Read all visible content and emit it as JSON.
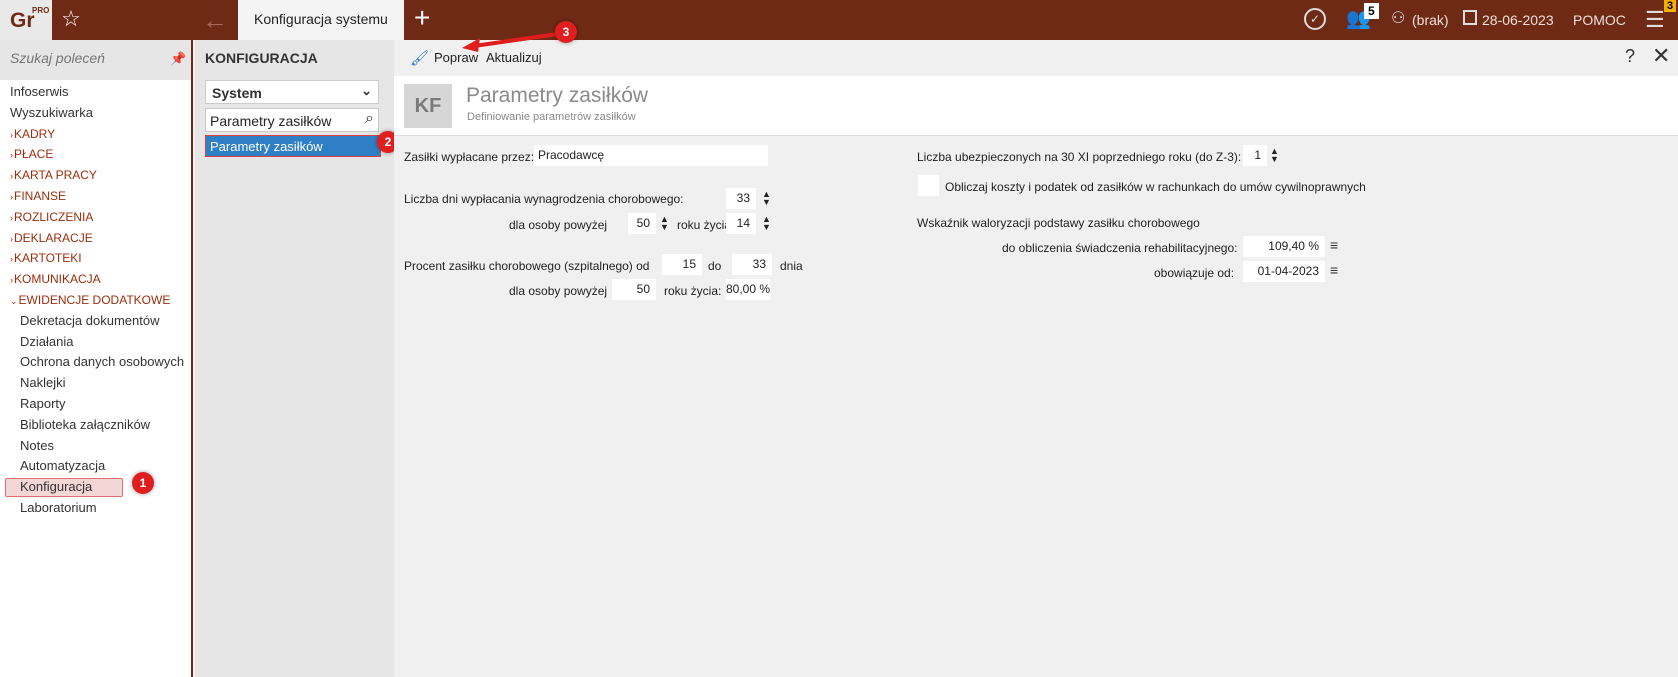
{
  "app": {
    "logo": "Gr",
    "logo_badge": "PRO",
    "active_tab": "Konfiguracja systemu",
    "users_count": "5",
    "operator": "(brak)",
    "date": "28-06-2023",
    "help": "POMOC",
    "menu_badge": "3"
  },
  "sidebar": {
    "search_placeholder": "Szukaj poleceń",
    "items": [
      {
        "label": "Infoserwis"
      },
      {
        "label": "Wyszukiwarka"
      },
      {
        "label": "KADRY"
      },
      {
        "label": "PŁACE"
      },
      {
        "label": "KARTA PRACY"
      },
      {
        "label": "FINANSE"
      },
      {
        "label": "ROZLICZENIA"
      },
      {
        "label": "DEKLARACJE"
      },
      {
        "label": "KARTOTEKI"
      },
      {
        "label": "KOMUNIKACJA"
      },
      {
        "label": "EWIDENCJE DODATKOWE"
      },
      {
        "label": "Dekretacja dokumentów"
      },
      {
        "label": "Działania"
      },
      {
        "label": "Ochrona danych osobowych"
      },
      {
        "label": "Naklejki"
      },
      {
        "label": "Raporty"
      },
      {
        "label": "Biblioteka załączników"
      },
      {
        "label": "Notes"
      },
      {
        "label": "Automatyzacja"
      },
      {
        "label": "Konfiguracja"
      },
      {
        "label": "Laboratorium"
      }
    ]
  },
  "config": {
    "title": "KONFIGURACJA",
    "select_value": "System",
    "search_value": "Parametry zasiłków",
    "result_item": "Parametry zasiłków"
  },
  "markers": {
    "m1": "1",
    "m2": "2",
    "m3": "3"
  },
  "toolbar": {
    "edit_label": "Popraw",
    "update_label": "Aktualizuj",
    "help_label": "?",
    "close_label": "✕"
  },
  "header": {
    "badge": "KF",
    "title": "Parametry zasiłków",
    "subtitle": "Definiowanie parametrów zasiłków"
  },
  "form": {
    "paid_by_label": "Zasiłki wypłacane przez:",
    "paid_by_value": "Pracodawcę",
    "sick_days_label": "Liczba dni wypłacania wynagrodzenia chorobowego:",
    "sick_days_value": "33",
    "over_person_label": "dla osoby powyżej",
    "over_days_value": "50",
    "age_label": "roku życia:",
    "age_days_value": "14",
    "percent_label": "Procent zasiłku chorobowego (szpitalnego) od",
    "percent_from": "15",
    "do_label": "do",
    "percent_to": "33",
    "dnia_label": "dnia",
    "over_person_label2": "dla osoby powyżej",
    "percent_age_value": "50",
    "age_label2": "roku życia:",
    "percent_value": "80,00 %",
    "insured_label": "Liczba ubezpieczonych na 30 XI poprzedniego roku (do Z-3):",
    "insured_value": "1",
    "costs_checkbox_label": "Obliczaj koszty i podatek od zasiłków w rachunkach do umów cywilnoprawnych",
    "valorization_label": "Wskaźnik waloryzacji podstawy zasiłku chorobowego",
    "rehab_label": "do obliczenia świadczenia rehabilitacyjnego:",
    "rehab_value": "109,40 %",
    "valid_from_label": "obowiązuje od:",
    "valid_from_value": "01-04-2023"
  },
  "colors": {
    "topbar": "#6e2a14",
    "section": "#9b2d0c",
    "selection": "#2f7fc6",
    "marker": "#e01e1e"
  }
}
